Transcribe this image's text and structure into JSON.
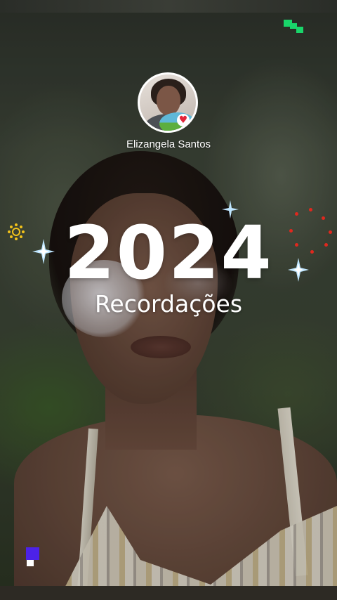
{
  "story": {
    "username": "Elizangela Santos",
    "year": "2024",
    "subtitle": "Recordações"
  },
  "icons": {
    "heart": "heart-icon",
    "sparkle": "sparkle-icon",
    "sun": "sun-icon",
    "confetti": "confetti-icon"
  },
  "colors": {
    "heart": "#e2263a",
    "accent_green": "#19d56a",
    "accent_purple": "#4c22e8",
    "sun": "#f2c21b",
    "confetti": "#e0281e",
    "sparkle": "#bfe6ff"
  }
}
